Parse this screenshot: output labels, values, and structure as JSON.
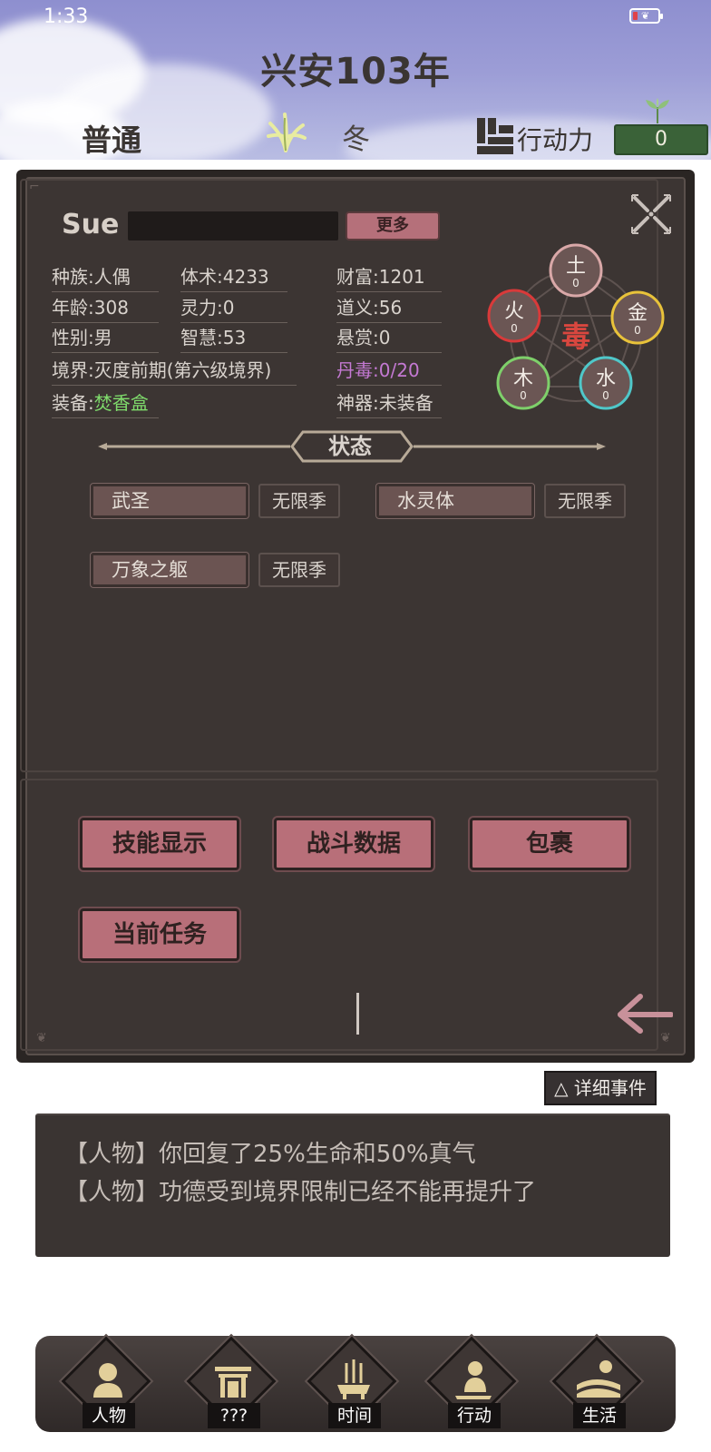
{
  "status_bar": {
    "time": "1:33"
  },
  "header": {
    "year": "兴安103年",
    "difficulty": "普通",
    "season": "冬",
    "action_points_label": "行动力",
    "action_points_value": "0"
  },
  "character": {
    "name": "Sue",
    "more_label": "更多",
    "stats": {
      "race": {
        "k": "种族:",
        "v": "人偶"
      },
      "body": {
        "k": "体术:",
        "v": "4233"
      },
      "wealth": {
        "k": "财富:",
        "v": "1201"
      },
      "age": {
        "k": "年龄:",
        "v": "308"
      },
      "spirit": {
        "k": "灵力:",
        "v": "0"
      },
      "justice": {
        "k": "道义:",
        "v": "56"
      },
      "gender": {
        "k": "性别:",
        "v": "男"
      },
      "wisdom": {
        "k": "智慧:",
        "v": "53"
      },
      "bounty": {
        "k": "悬赏:",
        "v": "0"
      },
      "realm": {
        "k": "境界:",
        "v": "灭度前期(第六级境界)"
      },
      "pill_poison": {
        "k": "丹毒:",
        "v": "0/20"
      },
      "equipment": {
        "k": "装备:",
        "v": "焚香盒"
      },
      "artifact": {
        "k": "神器:",
        "v": "未装备"
      }
    },
    "elements": {
      "center": "毒",
      "earth": {
        "label": "土",
        "value": "0"
      },
      "fire": {
        "label": "火",
        "value": "0"
      },
      "metal": {
        "label": "金",
        "value": "0"
      },
      "wood": {
        "label": "木",
        "value": "0"
      },
      "water": {
        "label": "水",
        "value": "0"
      }
    }
  },
  "status_section": {
    "title": "状态",
    "effects": [
      {
        "name": "武圣",
        "duration": "无限季"
      },
      {
        "name": "水灵体",
        "duration": "无限季"
      },
      {
        "name": "万象之躯",
        "duration": "无限季"
      }
    ]
  },
  "actions": {
    "skills": "技能显示",
    "battle_data": "战斗数据",
    "bag": "包裹",
    "current_task": "当前任务"
  },
  "events": {
    "detail_button": "△ 详细事件",
    "lines": [
      "【人物】你回复了25%生命和50%真气",
      "【人物】功德受到境界限制已经不能再提升了"
    ]
  },
  "nav": {
    "items": [
      "人物",
      "???",
      "时间",
      "行动",
      "生活"
    ]
  },
  "colors": {
    "panel_bg": "#3c3533",
    "button_pink": "#b86f79",
    "poison_purple": "#c479d3",
    "equip_green": "#7fdc6c",
    "ap_green": "#3a6238"
  }
}
